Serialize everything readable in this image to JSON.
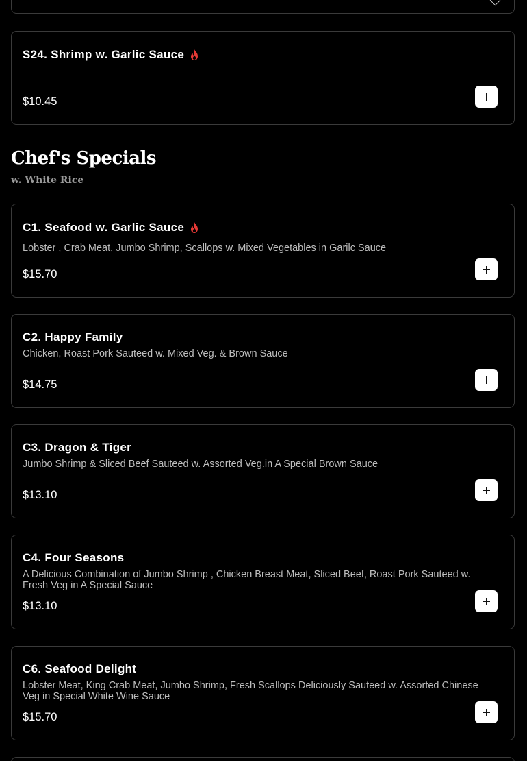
{
  "colors": {
    "background": "#000000",
    "card_border": "#3a3a3a",
    "text_primary": "#ffffff",
    "text_secondary": "#bdbdbd",
    "subtitle": "#9a9a9a",
    "spicy": "#e53935",
    "button_bg": "#ffffff"
  },
  "previous_item": {
    "title": "S24. Shrimp w. Garlic Sauce",
    "spicy": true,
    "price": "$10.45"
  },
  "section": {
    "title": "Chef's Specials",
    "subtitle": "w. White Rice"
  },
  "items": [
    {
      "title": "C1. Seafood w. Garlic Sauce",
      "spicy": true,
      "description": "Lobster , Crab Meat, Jumbo Shrimp, Scallops w. Mixed Vegetables in Garilc Sauce",
      "price": "$15.70"
    },
    {
      "title": "C2. Happy Family",
      "spicy": false,
      "description": "Chicken, Roast Pork Sauteed w. Mixed Veg. & Brown Sauce",
      "price": "$14.75"
    },
    {
      "title": "C3. Dragon & Tiger",
      "spicy": false,
      "description": "Jumbo Shrimp & Sliced Beef Sauteed w. Assorted Veg.in A Special Brown Sauce",
      "price": "$13.10"
    },
    {
      "title": "C4. Four Seasons",
      "spicy": false,
      "description": "A Delicious Combination of Jumbo Shrimp , Chicken Breast Meat, Sliced Beef, Roast Pork Sauteed w. Fresh Veg in A Special Sauce",
      "price": "$13.10"
    },
    {
      "title": "C6. Seafood Delight",
      "spicy": false,
      "description": "Lobster Meat, King Crab Meat, Jumbo Shrimp, Fresh Scallops Deliciously Sauteed w. Assorted Chinese Veg in Special White Wine Sauce",
      "price": "$15.70"
    }
  ],
  "icons": {
    "spicy": "flame-icon",
    "add": "plus-icon",
    "expand": "chevron-down-icon"
  }
}
